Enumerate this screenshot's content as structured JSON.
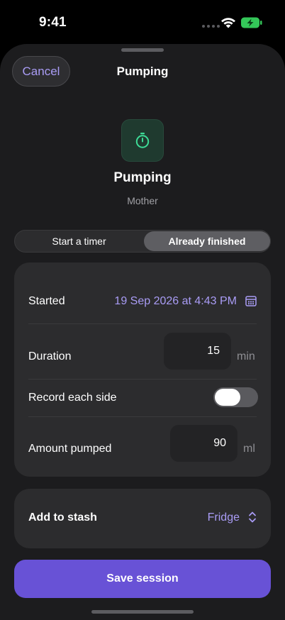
{
  "status_bar": {
    "time": "9:41"
  },
  "sheet": {
    "cancel_label": "Cancel",
    "title": "Pumping"
  },
  "hero": {
    "icon": "stopwatch-icon",
    "title": "Pumping",
    "subtitle": "Mother"
  },
  "mode": {
    "options": [
      "Start a timer",
      "Already finished"
    ],
    "selected": "Already finished"
  },
  "form": {
    "started": {
      "label": "Started",
      "value": "19 Sep 2026 at 4:43 PM",
      "icon": "calendar-icon"
    },
    "duration": {
      "label": "Duration",
      "value": "15",
      "unit": "min"
    },
    "record_each_side": {
      "label": "Record each side",
      "enabled": false
    },
    "amount": {
      "label": "Amount pumped",
      "value": "90",
      "unit": "ml"
    }
  },
  "stash": {
    "label": "Add to stash",
    "value": "Fridge",
    "icon": "chevron-up-down-icon"
  },
  "save_label": "Save session",
  "colors": {
    "accent": "#a99cf5",
    "primary_button": "#6852d6",
    "hero_icon": "#3ddc97",
    "battery": "#34c759"
  }
}
